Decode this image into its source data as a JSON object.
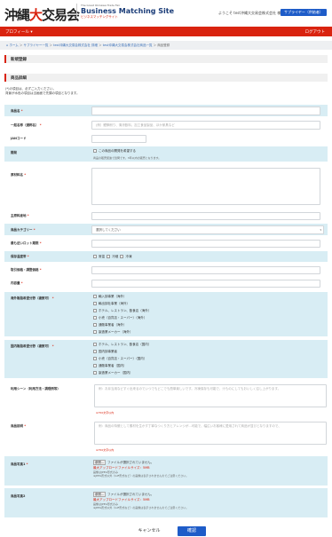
{
  "header": {
    "logo_prefix": "沖縄",
    "logo_red": "大",
    "logo_suffix": "交易会",
    "logo_en_small": "The Great Okinawa Trade Fair",
    "logo_en_main": "Business Matching Site",
    "logo_en_sub": "ビジネスマッチングサイト",
    "welcome": "ようこそ test沖縄大交易会株式会社 様",
    "supplier_button": "サプライヤー（供給者）"
  },
  "nav": {
    "profile": "プロフィール ▾",
    "logout": "ログアウト"
  },
  "breadcrumb": {
    "home": "ホーム",
    "sep": " ＞ ",
    "supplier_list": "サプライヤー一覧",
    "company_detail": "test沖縄大交易会株式会社 詳細",
    "product_list": "test沖縄大交易会株式会社商品一覧",
    "current": "商品登録"
  },
  "page_title": "新規登録",
  "section_title": "商品詳細",
  "notes": [
    "(*)の項目は、必ずご入力ください。",
    "背景が水色の項目は当画面で先頭の項目となります。"
  ],
  "form": {
    "product_name": "商品名",
    "general_name": "一般名称（通称名）",
    "general_name_placeholder": "(例）鰹節削り、清涼飲料、加工食品製品、ほか家具など",
    "jan": "JANコード",
    "dev": "開発",
    "dev_check": "この商品の開発を希望する",
    "dev_note": "商品の販売促進で質問です。3年以内の販売となります。",
    "raw": "原材料名",
    "origin": "主原料産地",
    "category": "商品カテゴリー",
    "category_value": "選択してください",
    "best_before": "最も近いロット期限",
    "temp": "保存温度帯",
    "temp_opts": [
      "常温",
      "冷蔵",
      "冷凍"
    ],
    "price": "取引価格・調整価格",
    "capacity": "内容量",
    "overseas": "海外販路希望分野（複数可）",
    "overseas_opts": [
      "輸入卸事業（海外）",
      "輸出卸社事業（海外）",
      "ホテル、レストラン、飲食店（海外）",
      "小売（百貨店・スーパー）（海外）",
      "通販事業者（海外）",
      "製造業メーカー（海外）"
    ],
    "domestic": "国内販路希望分野（複数可）",
    "domestic_opts": [
      "ホテル、レストラン、飲食店（国内）",
      "国内卸事業者",
      "小売（百貨店・スーパー）（国内）",
      "通販事業者（国内）",
      "製造業メーカー（国内）"
    ],
    "scene": "利用シーン（利用方法・調理例等）",
    "scene_placeholder": "例：お弁当用などすぐ出来るのでいつでもどこでも簡単楽しいです。冷凍保存も可能で、汁ものにしてもおいしく召し上がります。",
    "scene_count": "※750文字以内",
    "desc": "商品説明",
    "desc_placeholder": "例：商品の特徴として素材を生かす丁寧なつくり方とアレンジが...可能で、幅広いお客様に愛用されて商品が並びとなりますので、",
    "desc_count": "※750文字以内",
    "img1": "商品写真1",
    "img2": "商品写真2",
    "file_btn": "参照...",
    "no_file": "ファイルが選択されていません。",
    "max": "最大アップロードファイルサイズ：5MB",
    "hint1": "画像はJPEG形式のみ",
    "hint2": "※JPEG形式以外（GIF形式など）の画像は表示されませんのでご注意ください。"
  },
  "buttons": {
    "cancel": "キャンセル",
    "confirm": "確認"
  }
}
